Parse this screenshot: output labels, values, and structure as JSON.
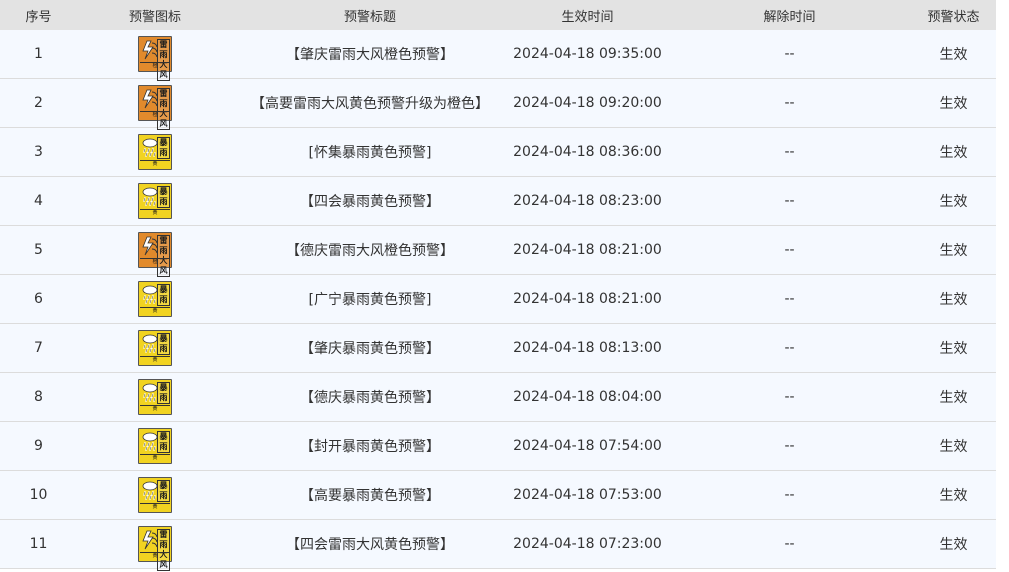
{
  "colors": {
    "header_bg": "#e3e3e3",
    "row_bg": "#f5f9ff",
    "orange": "#e18a2c",
    "yellow": "#f1d321"
  },
  "table": {
    "headers": [
      "序号",
      "预警图标",
      "预警标题",
      "生效时间",
      "解除时间",
      "预警状态"
    ],
    "rows": [
      {
        "no": "1",
        "icon": "thunder-wind-orange-icon",
        "icon_text": [
          "雷",
          "雨",
          "大",
          "风"
        ],
        "icon_level": "橙",
        "icon_label": "THUNDER-GUST",
        "title": "【肇庆雷雨大风橙色预警】",
        "start": "2024-04-18 09:35:00",
        "end": "--",
        "status": "生效"
      },
      {
        "no": "2",
        "icon": "thunder-wind-orange-icon",
        "icon_text": [
          "雷",
          "雨",
          "大",
          "风"
        ],
        "icon_level": "橙",
        "icon_label": "THUNDER-GUST",
        "title": "【高要雷雨大风黄色预警升级为橙色】",
        "start": "2024-04-18 09:20:00",
        "end": "--",
        "status": "生效"
      },
      {
        "no": "3",
        "icon": "rainstorm-yellow-icon",
        "icon_text": [
          "暴",
          "雨"
        ],
        "icon_level": "黄",
        "icon_label": "RAINSTORM",
        "title": "[怀集暴雨黄色预警]",
        "start": "2024-04-18 08:36:00",
        "end": "--",
        "status": "生效"
      },
      {
        "no": "4",
        "icon": "rainstorm-yellow-icon",
        "icon_text": [
          "暴",
          "雨"
        ],
        "icon_level": "黄",
        "icon_label": "RAINSTORM",
        "title": "【四会暴雨黄色预警】",
        "start": "2024-04-18 08:23:00",
        "end": "--",
        "status": "生效"
      },
      {
        "no": "5",
        "icon": "thunder-wind-orange-icon",
        "icon_text": [
          "雷",
          "雨",
          "大",
          "风"
        ],
        "icon_level": "橙",
        "icon_label": "THUNDER-GUST",
        "title": "【德庆雷雨大风橙色预警】",
        "start": "2024-04-18 08:21:00",
        "end": "--",
        "status": "生效"
      },
      {
        "no": "6",
        "icon": "rainstorm-yellow-icon",
        "icon_text": [
          "暴",
          "雨"
        ],
        "icon_level": "黄",
        "icon_label": "RAINSTORM",
        "title": "[广宁暴雨黄色预警]",
        "start": "2024-04-18 08:21:00",
        "end": "--",
        "status": "生效"
      },
      {
        "no": "7",
        "icon": "rainstorm-yellow-icon",
        "icon_text": [
          "暴",
          "雨"
        ],
        "icon_level": "黄",
        "icon_label": "RAINSTORM",
        "title": "【肇庆暴雨黄色预警】",
        "start": "2024-04-18 08:13:00",
        "end": "--",
        "status": "生效"
      },
      {
        "no": "8",
        "icon": "rainstorm-yellow-icon",
        "icon_text": [
          "暴",
          "雨"
        ],
        "icon_level": "黄",
        "icon_label": "RAINSTORM",
        "title": "【德庆暴雨黄色预警】",
        "start": "2024-04-18 08:04:00",
        "end": "--",
        "status": "生效"
      },
      {
        "no": "9",
        "icon": "rainstorm-yellow-icon",
        "icon_text": [
          "暴",
          "雨"
        ],
        "icon_level": "黄",
        "icon_label": "RAINSTORM",
        "title": "【封开暴雨黄色预警】",
        "start": "2024-04-18 07:54:00",
        "end": "--",
        "status": "生效"
      },
      {
        "no": "10",
        "icon": "rainstorm-yellow-icon",
        "icon_text": [
          "暴",
          "雨"
        ],
        "icon_level": "黄",
        "icon_label": "RAINSTORM",
        "title": "【高要暴雨黄色预警】",
        "start": "2024-04-18 07:53:00",
        "end": "--",
        "status": "生效"
      },
      {
        "no": "11",
        "icon": "thunder-wind-yellow-icon",
        "icon_text": [
          "雷",
          "雨",
          "大",
          "风"
        ],
        "icon_level": "黄",
        "icon_label": "THUNDER-GUST",
        "title": "【四会雷雨大风黄色预警】",
        "start": "2024-04-18 07:23:00",
        "end": "--",
        "status": "生效"
      }
    ]
  }
}
